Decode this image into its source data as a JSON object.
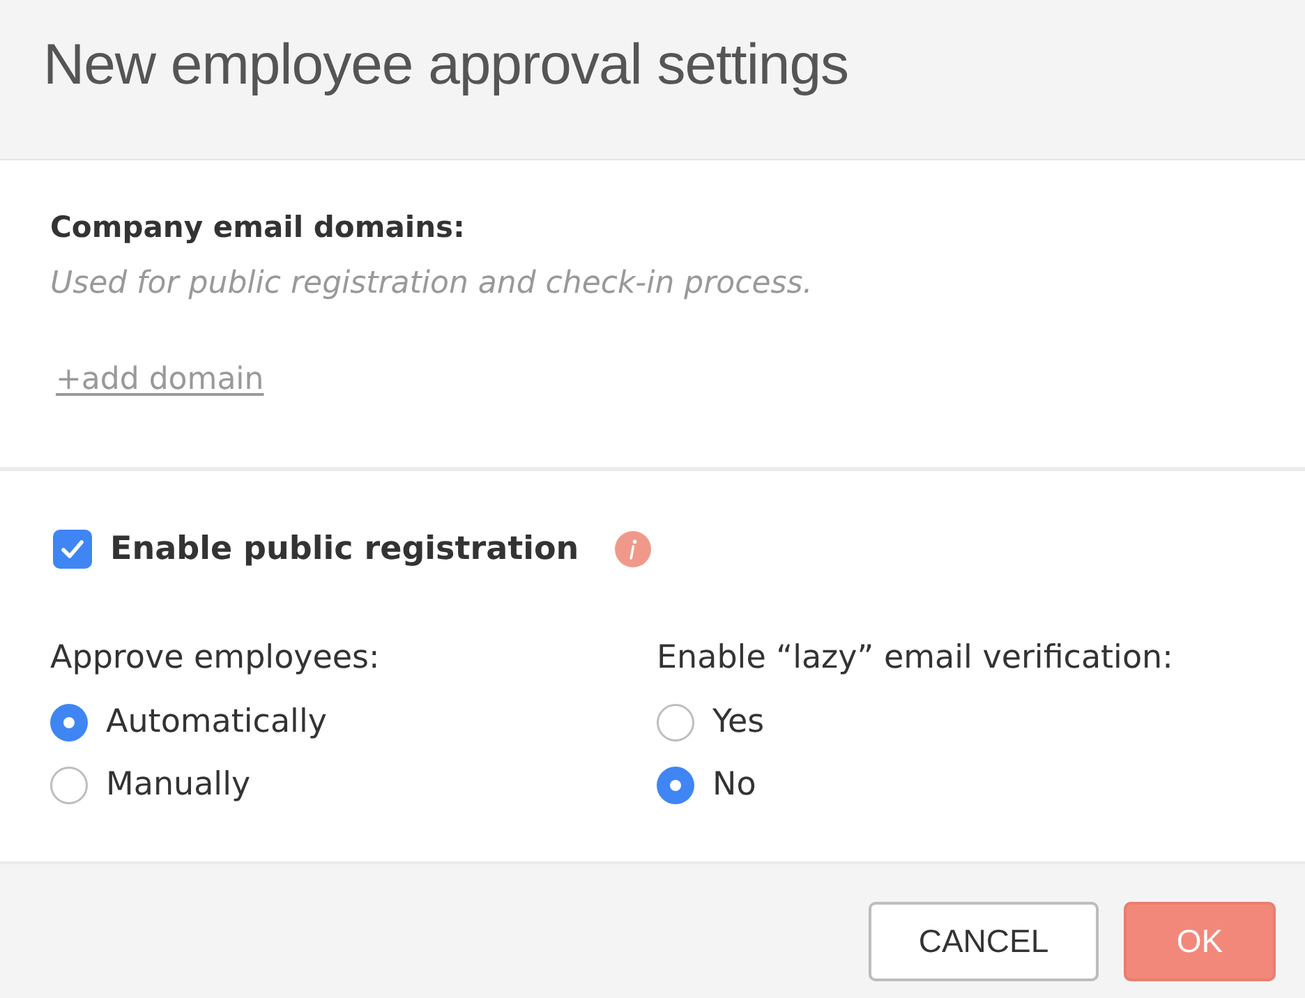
{
  "dialog": {
    "title": "New employee approval settings"
  },
  "domains": {
    "heading": "Company email domains:",
    "description": "Used for public registration and check-in process.",
    "add_link": "+add domain"
  },
  "registration": {
    "label": "Enable public registration",
    "checked": true
  },
  "radio_groups": [
    {
      "label": "Approve employees:",
      "options": [
        {
          "label": "Automatically",
          "selected": true
        },
        {
          "label": "Manually",
          "selected": false
        }
      ]
    },
    {
      "label": "Enable “lazy” email verification:",
      "options": [
        {
          "label": "Yes",
          "selected": false
        },
        {
          "label": "No",
          "selected": true
        }
      ]
    }
  ],
  "buttons": [
    {
      "label": "CANCEL",
      "kind": "secondary"
    },
    {
      "label": "OK",
      "kind": "primary"
    }
  ]
}
